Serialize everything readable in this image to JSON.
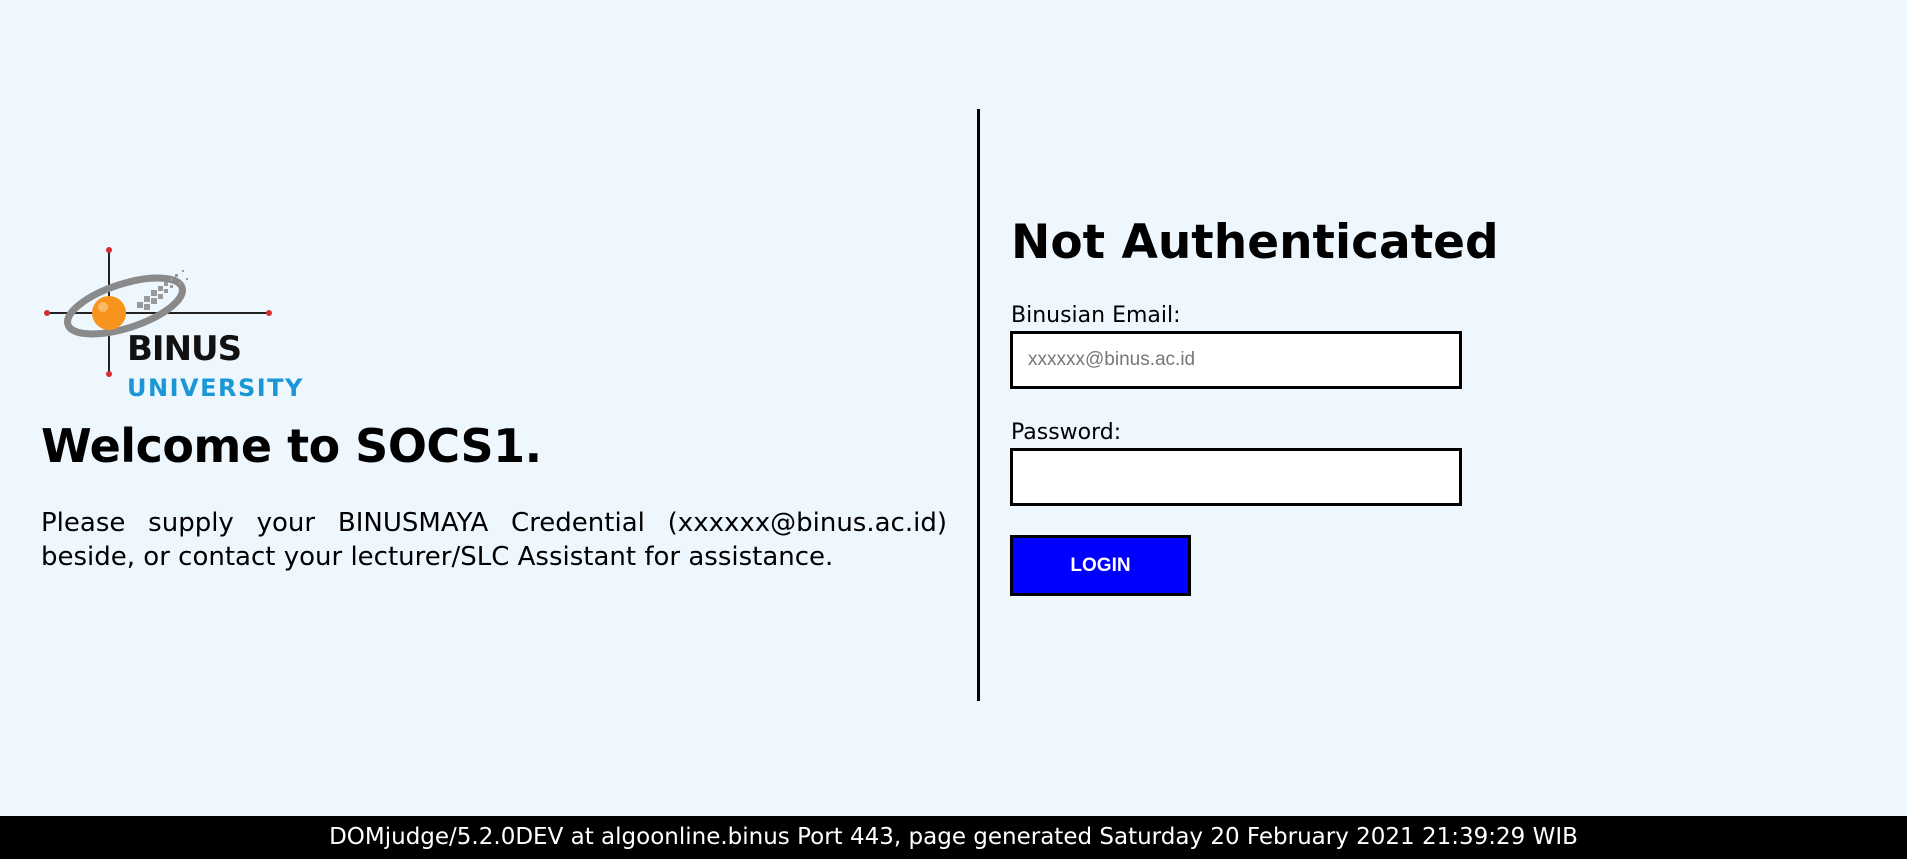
{
  "logo": {
    "brand": "BINUS",
    "subtitle": "UNIVERSITY",
    "icon": "binus-university-logo-icon",
    "accent_orange": "#f7941d",
    "accent_blue": "#1b97d6"
  },
  "welcome": {
    "heading": "Welcome to SOCS1.",
    "instructions": "Please supply your BINUSMAYA Credential (xxxxxx@binus.ac.id) beside, or contact your lecturer/SLC Assistant for assistance."
  },
  "login": {
    "title": "Not Authenticated",
    "email_label": "Binusian Email:",
    "email_placeholder": "xxxxxx@binus.ac.id",
    "email_value": "",
    "password_label": "Password:",
    "password_value": "",
    "button_label": "LOGIN",
    "button_color": "#0000ff"
  },
  "footer": {
    "text": "DOMjudge/5.2.0DEV at algoonline.binus Port 443, page generated Saturday 20 February 2021 21:39:29 WIB"
  },
  "colors": {
    "background": "#eef6fe",
    "footer_background": "#000000"
  }
}
